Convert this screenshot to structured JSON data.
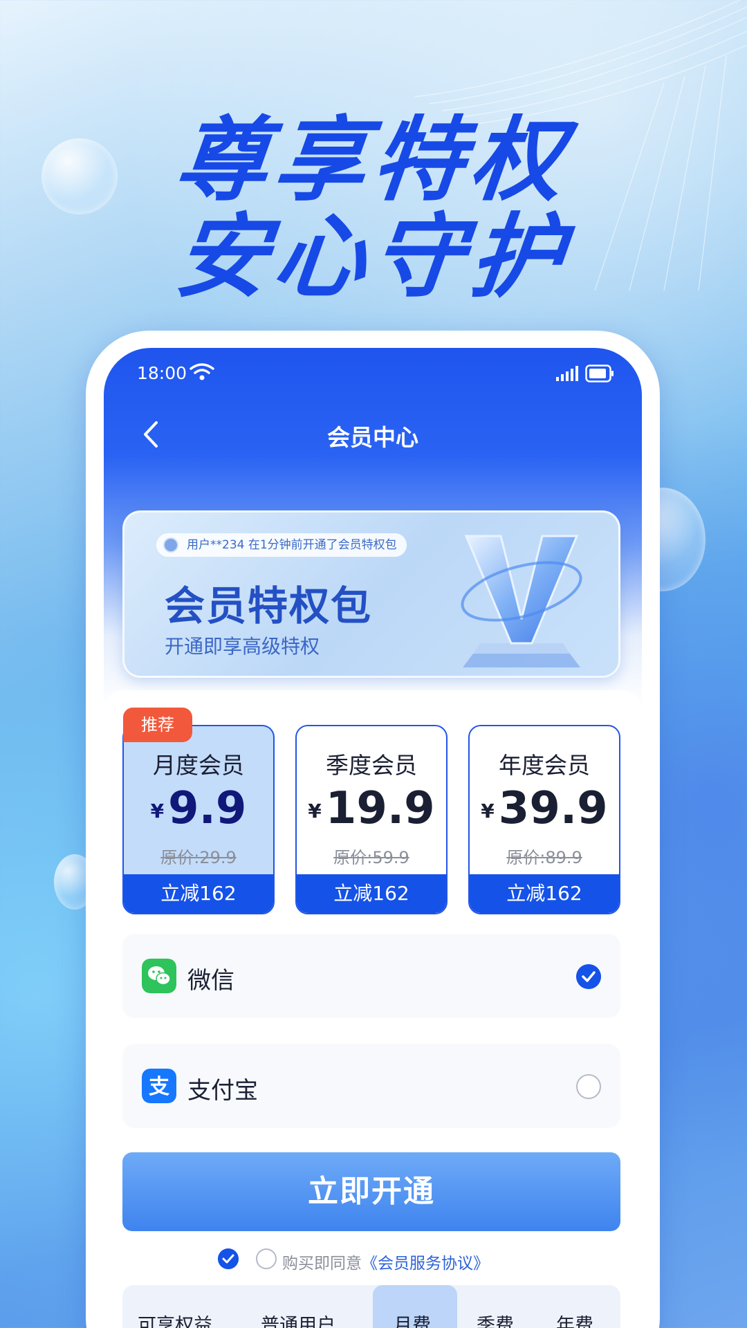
{
  "headline": {
    "line1": "尊享特权",
    "line2": "安心守护"
  },
  "status_bar": {
    "time": "18:00"
  },
  "nav": {
    "title": "会员中心"
  },
  "banner": {
    "ticker": "用户**234 在1分钟前开通了会员特权包",
    "title": "会员特权包",
    "subtitle": "开通即享高级特权"
  },
  "badge": "推荐",
  "plans": [
    {
      "name": "月度会员",
      "currency": "¥",
      "price": "9.9",
      "original": "原价:29.9",
      "discount": "立减162",
      "selected": true
    },
    {
      "name": "季度会员",
      "currency": "¥",
      "price": "19.9",
      "original": "原价:59.9",
      "discount": "立减162",
      "selected": false
    },
    {
      "name": "年度会员",
      "currency": "¥",
      "price": "39.9",
      "original": "原价:89.9",
      "discount": "立减162",
      "selected": false
    }
  ],
  "payment": {
    "wechat": {
      "label": "微信",
      "checked": true
    },
    "alipay": {
      "label": "支付宝",
      "checked": false
    }
  },
  "cta": "立即开通",
  "agreement": {
    "text": "购买即同意",
    "link": "《会员服务协议》"
  },
  "compare": {
    "tabs": [
      "可享权益",
      "普通用户",
      "月费",
      "季费",
      "年费"
    ]
  },
  "colors": {
    "brand_blue": "#1552e8",
    "headline_blue": "#1749e6",
    "badge_orange": "#f2583b",
    "wechat_green": "#2ec35b",
    "alipay_blue": "#1677ff"
  }
}
